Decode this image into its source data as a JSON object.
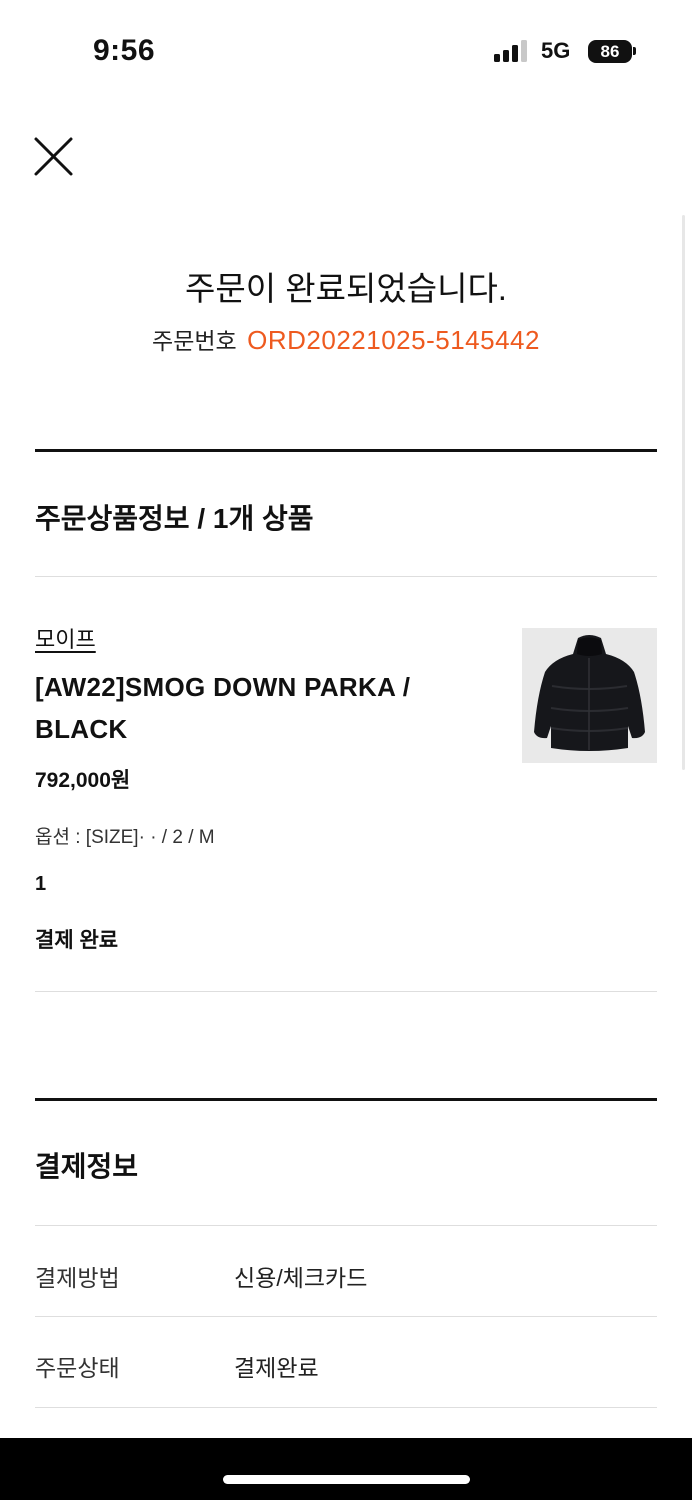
{
  "status_bar": {
    "time": "9:56",
    "network": "5G",
    "battery": "86"
  },
  "header": {
    "close_icon": "close-icon"
  },
  "confirmation": {
    "title": "주문이 완료되었습니다.",
    "order_number_label": "주문번호",
    "order_number": "ORD20221025-5145442"
  },
  "order_items": {
    "section_title": "주문상품정보 / 1개 상품",
    "item": {
      "brand": "모이프",
      "name": "[AW22]SMOG DOWN PARKA / BLACK",
      "price": "792,000원",
      "option": "옵션 : [SIZE]· · / 2 / M",
      "quantity": "1",
      "status": "결제 완료"
    }
  },
  "payment": {
    "section_title": "결제정보",
    "rows": [
      {
        "label": "결제방법",
        "value": "신용/체크카드"
      },
      {
        "label": "주문상태",
        "value": "결제완료"
      }
    ]
  },
  "colors": {
    "accent": "#ee5a1f",
    "text": "#111111",
    "divider": "#dedede"
  }
}
